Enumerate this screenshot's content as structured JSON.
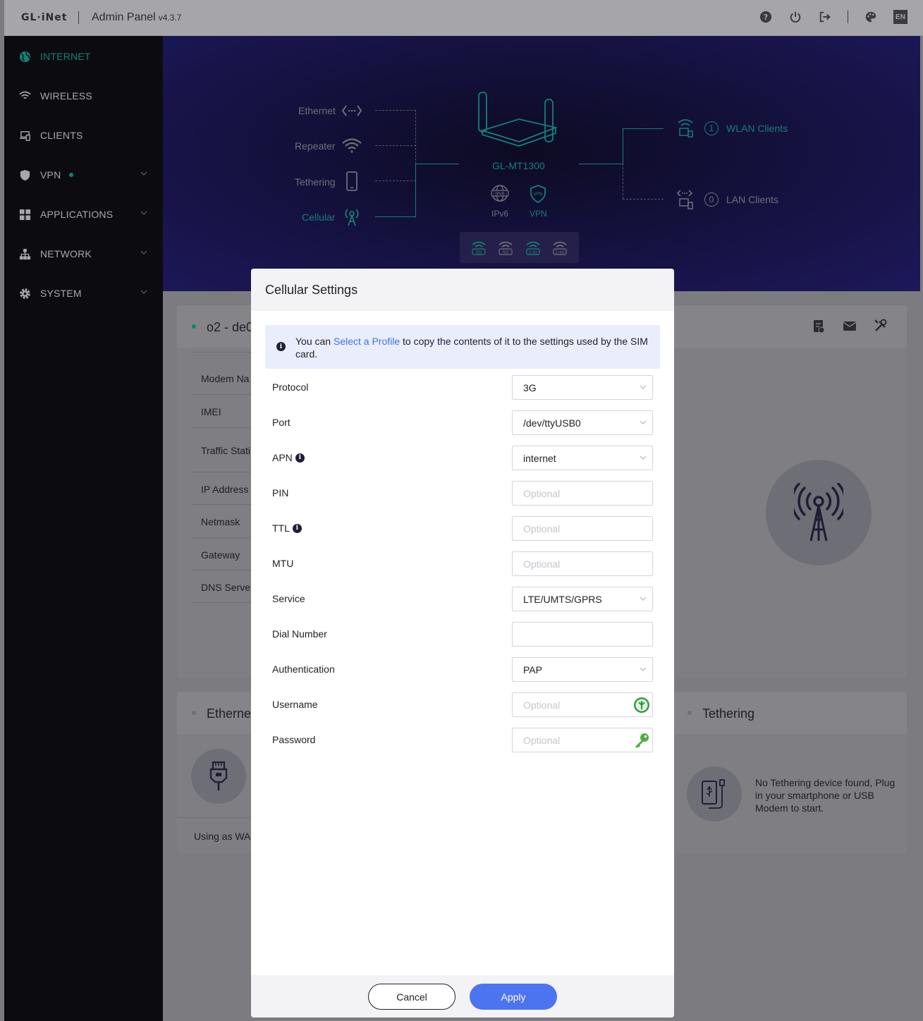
{
  "topbar": {
    "logo": "GL·iNet",
    "title": "Admin Panel",
    "version": "v4.3.7",
    "lang": "EN"
  },
  "sidebar": {
    "items": [
      {
        "label": "INTERNET",
        "icon": "globe-icon"
      },
      {
        "label": "WIRELESS",
        "icon": "wifi-icon"
      },
      {
        "label": "CLIENTS",
        "icon": "devices-icon"
      },
      {
        "label": "VPN",
        "icon": "shield-icon"
      },
      {
        "label": "APPLICATIONS",
        "icon": "apps-grid-icon"
      },
      {
        "label": "NETWORK",
        "icon": "network-tree-icon"
      },
      {
        "label": "SYSTEM",
        "icon": "gear-icon"
      }
    ]
  },
  "banner": {
    "ethernet": "Ethernet",
    "repeater": "Repeater",
    "tethering": "Tethering",
    "cellular": "Cellular",
    "device": "GL-MT1300",
    "ipv6": "IPv6",
    "vpn": "VPN",
    "wlan_count": "1",
    "wlan_label": "WLAN Clients",
    "lan_count": "0",
    "lan_label": "LAN Clients",
    "wifi_bands": [
      "5G",
      "5G",
      "2.4G",
      "2.4G"
    ]
  },
  "cellular_card": {
    "title": "o2 - de0",
    "labels": [
      "Modem Na",
      "IMEI",
      "Traffic Stati",
      "IP Address",
      "Netmask",
      "Gateway",
      "DNS Server"
    ]
  },
  "ethernet_card": {
    "title": "Etherne",
    "footer": "Using as WA"
  },
  "tethering_card": {
    "title": "Tethering",
    "message": "No Tethering device found, Plug in your smartphone or USB Modem to start."
  },
  "modal": {
    "title": "Cellular Settings",
    "notice_pre": "You can ",
    "notice_link": "Select a Profile",
    "notice_post": " to copy the contents of it to the settings used by the SIM card.",
    "fields": {
      "protocol": {
        "label": "Protocol",
        "value": "3G"
      },
      "port": {
        "label": "Port",
        "value": "/dev/ttyUSB0"
      },
      "apn": {
        "label": "APN",
        "value": "internet"
      },
      "pin": {
        "label": "PIN",
        "placeholder": "Optional"
      },
      "ttl": {
        "label": "TTL",
        "placeholder": "Optional"
      },
      "mtu": {
        "label": "MTU",
        "placeholder": "Optional"
      },
      "service": {
        "label": "Service",
        "value": "LTE/UMTS/GPRS"
      },
      "dial": {
        "label": "Dial Number",
        "value": ""
      },
      "auth": {
        "label": "Authentication",
        "value": "PAP"
      },
      "username": {
        "label": "Username",
        "placeholder": "Optional"
      },
      "password": {
        "label": "Password",
        "placeholder": "Optional"
      }
    },
    "cancel": "Cancel",
    "apply": "Apply"
  },
  "colors": {
    "accent": "#157f76",
    "primary_button": "#4d74f0",
    "link": "#3e6fe8",
    "sidebar_bg": "#0c0c10"
  }
}
